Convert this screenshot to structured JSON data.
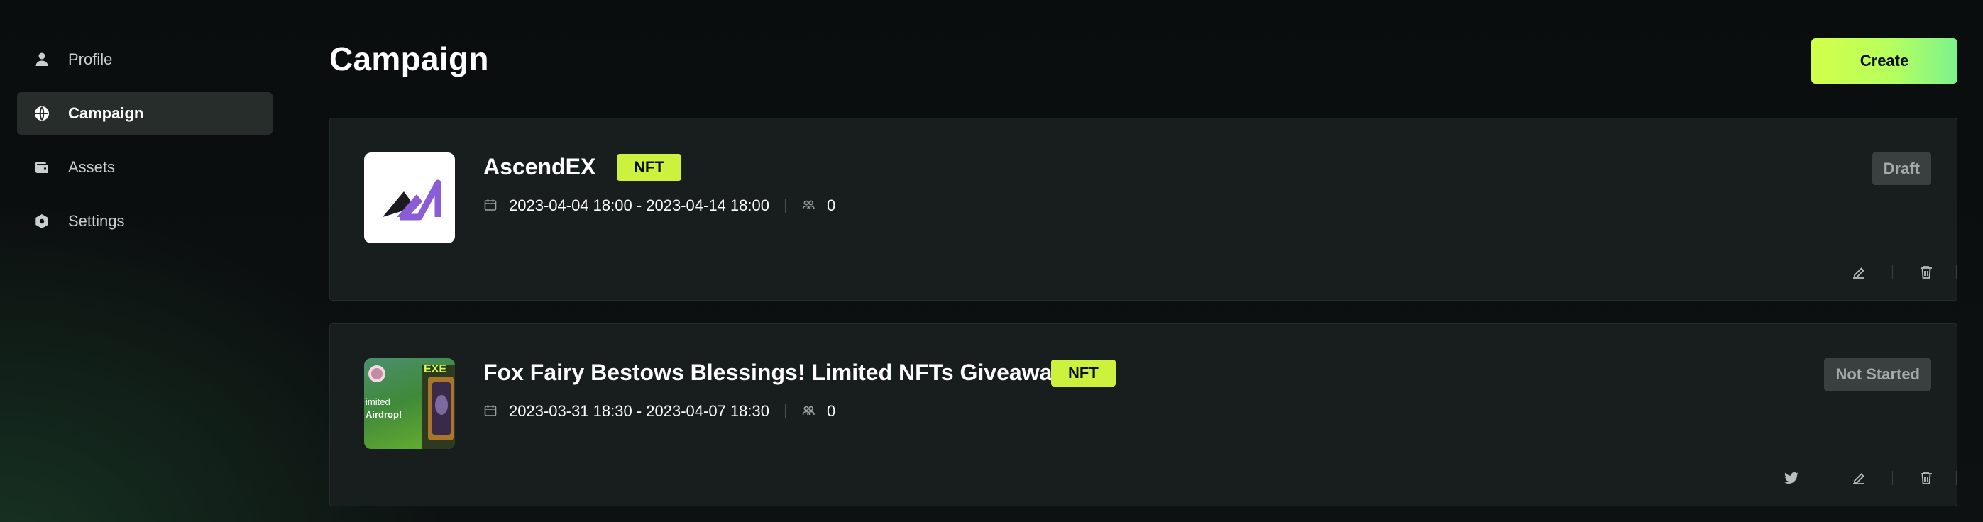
{
  "sidebar": {
    "items": [
      {
        "label": "Profile",
        "icon": "user-icon",
        "active": false
      },
      {
        "label": "Campaign",
        "icon": "globe-icon",
        "active": true
      },
      {
        "label": "Assets",
        "icon": "wallet-icon",
        "active": false
      },
      {
        "label": "Settings",
        "icon": "gear-icon",
        "active": false
      }
    ]
  },
  "header": {
    "title": "Campaign",
    "create_label": "Create"
  },
  "campaigns": [
    {
      "title": "AscendEX",
      "tag": "NFT",
      "date_range": "2023-04-04 18:00 - 2023-04-14 18:00",
      "participants": "0",
      "status": "Draft",
      "thumbnail": "ascendex-logo",
      "actions": [
        "edit-icon",
        "delete-icon"
      ]
    },
    {
      "title": "Fox Fairy Bestows Blessings! Limited NFTs Giveaway!",
      "tag": "NFT",
      "date_range": "2023-03-31 18:30 - 2023-04-07 18:30",
      "participants": "0",
      "status": "Not Started",
      "thumbnail": "fox-fairy-airdrop-art",
      "thumbnail_text": "imited\nAirdrop!",
      "actions": [
        "twitter-icon",
        "edit-icon",
        "delete-icon"
      ]
    }
  ],
  "colors": {
    "accent": "#cdf23d",
    "create_gradient_start": "#d3ff4a",
    "create_gradient_end": "#7cf28c",
    "card_bg": "#181d1d",
    "status_bg": "#3a3f3f"
  }
}
